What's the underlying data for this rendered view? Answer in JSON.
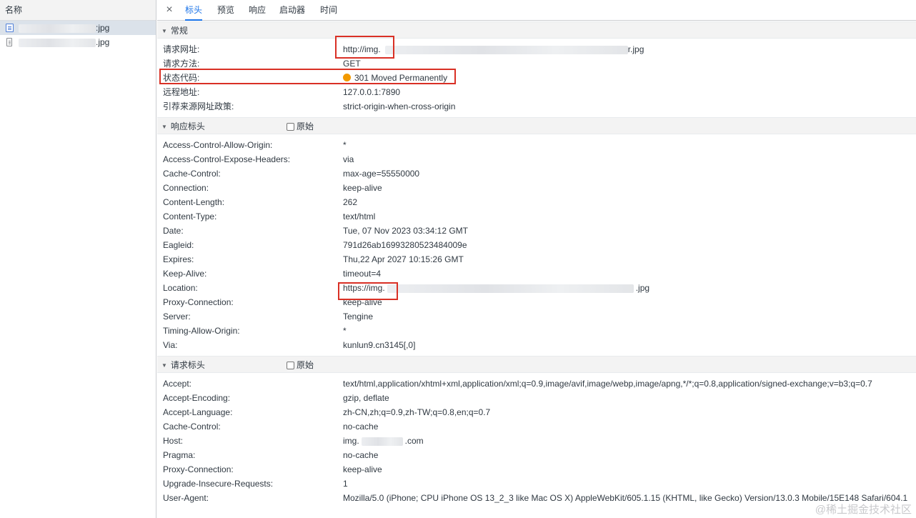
{
  "left": {
    "header": "名称",
    "requests": [
      {
        "name_suffix": ":jpg",
        "selected": true,
        "icon": "document-icon"
      },
      {
        "name_suffix": ".jpg",
        "selected": false,
        "icon": "file-icon"
      }
    ]
  },
  "tabs": {
    "close_icon": "×",
    "items": [
      "标头",
      "预览",
      "响应",
      "启动器",
      "时间"
    ],
    "active": "标头"
  },
  "general": {
    "title": "常规",
    "rows": [
      {
        "key": "请求网址:",
        "prefix": "http://img.",
        "suffix": "r.jpg"
      },
      {
        "key": "请求方法:",
        "value": "GET"
      },
      {
        "key": "状态代码:",
        "value": "301 Moved Permanently",
        "status_color": "#f29900"
      },
      {
        "key": "远程地址:",
        "value": "127.0.0.1:7890"
      },
      {
        "key": "引荐来源网址政策:",
        "value": "strict-origin-when-cross-origin"
      }
    ]
  },
  "response_headers": {
    "title": "响应标头",
    "raw_label": "原始",
    "rows": [
      {
        "key": "Access-Control-Allow-Origin:",
        "value": "*"
      },
      {
        "key": "Access-Control-Expose-Headers:",
        "value": "via"
      },
      {
        "key": "Cache-Control:",
        "value": "max-age=55550000"
      },
      {
        "key": "Connection:",
        "value": "keep-alive"
      },
      {
        "key": "Content-Length:",
        "value": "262"
      },
      {
        "key": "Content-Type:",
        "value": "text/html"
      },
      {
        "key": "Date:",
        "value": "Tue, 07 Nov 2023 03:34:12 GMT"
      },
      {
        "key": "Eagleid:",
        "value": "791d26ab16993280523484009e"
      },
      {
        "key": "Expires:",
        "value": "Thu,22 Apr 2027 10:15:26 GMT"
      },
      {
        "key": "Keep-Alive:",
        "value": "timeout=4"
      },
      {
        "key": "Location:",
        "prefix": "https://img.",
        "suffix": ".jpg"
      },
      {
        "key": "Proxy-Connection:",
        "value": "keep-alive"
      },
      {
        "key": "Server:",
        "value": "Tengine"
      },
      {
        "key": "Timing-Allow-Origin:",
        "value": "*"
      },
      {
        "key": "Via:",
        "value": "kunlun9.cn3145[,0]"
      }
    ]
  },
  "request_headers": {
    "title": "请求标头",
    "raw_label": "原始",
    "rows": [
      {
        "key": "Accept:",
        "value": "text/html,application/xhtml+xml,application/xml;q=0.9,image/avif,image/webp,image/apng,*/*;q=0.8,application/signed-exchange;v=b3;q=0.7"
      },
      {
        "key": "Accept-Encoding:",
        "value": "gzip, deflate"
      },
      {
        "key": "Accept-Language:",
        "value": "zh-CN,zh;q=0.9,zh-TW;q=0.8,en;q=0.7"
      },
      {
        "key": "Cache-Control:",
        "value": "no-cache"
      },
      {
        "key": "Host:",
        "prefix": "img.",
        "suffix": ".com"
      },
      {
        "key": "Pragma:",
        "value": "no-cache"
      },
      {
        "key": "Proxy-Connection:",
        "value": "keep-alive"
      },
      {
        "key": "Upgrade-Insecure-Requests:",
        "value": "1"
      },
      {
        "key": "User-Agent:",
        "value": "Mozilla/5.0 (iPhone; CPU iPhone OS 13_2_3 like Mac OS X) AppleWebKit/605.1.15 (KHTML, like Gecko) Version/13.0.3 Mobile/15E148 Safari/604.1"
      }
    ]
  },
  "watermark": "@稀土掘金技术社区",
  "highlight_color": "#d93025"
}
